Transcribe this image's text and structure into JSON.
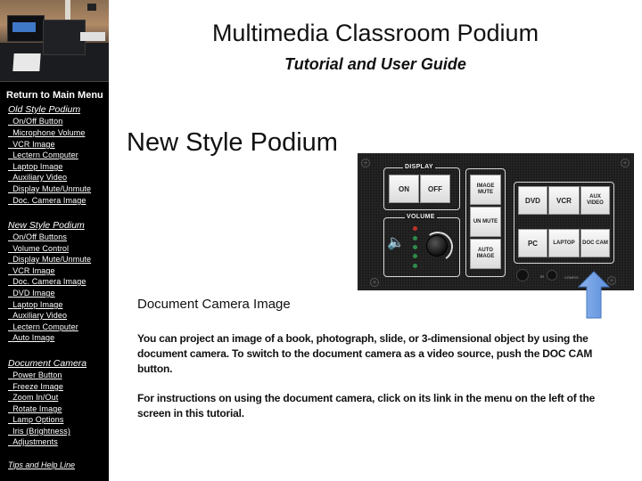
{
  "header": {
    "title": "Multimedia Classroom Podium",
    "subtitle": "Tutorial and User Guide"
  },
  "sidebar": {
    "hero_image": "classroom-podium-photo",
    "return_link": "Return to Main Menu",
    "sections": [
      {
        "title": "Old Style Podium",
        "items": [
          "On/Off Button",
          "Microphone Volume",
          "VCR Image",
          "Lectern Computer",
          "Laptop Image",
          "Auxiliary Video",
          "Display Mute/Unmute",
          "Doc. Camera Image"
        ]
      },
      {
        "title": "New Style Podium",
        "items": [
          "On/Off Buttons",
          "Volume Control",
          "Display Mute/Unmute",
          "VCR Image",
          "Doc. Camera Image",
          "DVD Image",
          "Laptop Image",
          "Auxiliary Video",
          "Lectern Computer",
          "Auto Image"
        ]
      },
      {
        "title": "Document Camera",
        "items": [
          "Power Button",
          "Freeze Image",
          "Zoom In/Out",
          "Rotate Image",
          "Lamp Options",
          "Iris (Brightness)",
          "Adjustments"
        ]
      }
    ],
    "footer_link": "Tips and Help Line"
  },
  "main": {
    "page_heading": "New Style Podium",
    "section_heading": "Document Camera Image",
    "paragraphs": [
      "You can project an image of a book, photograph, slide, or 3-dimensional object by using the document camera. To switch to the document camera as a video source, push the DOC CAM button.",
      "For instructions on using the document camera, click on its link in the menu on the left of the screen in this tutorial."
    ]
  },
  "panel": {
    "display_label": "DISPLAY",
    "display_on": "ON",
    "display_off": "OFF",
    "volume_label": "VOLUME",
    "image_mute": "IMAGE MUTE",
    "unmute": "UN MUTE",
    "auto_image": "AUTO IMAGE",
    "sources": [
      "DVD",
      "VCR",
      "AUX VIDEO",
      "PC",
      "LAPTOP",
      "DOC CAM"
    ],
    "ir_label": "IR",
    "config_label": "CONFIG",
    "highlighted_source": "DOC CAM",
    "colors": {
      "arrow": "#6f9fe0",
      "led_red": "#c0302a",
      "led_green": "#2f8a4a"
    }
  }
}
